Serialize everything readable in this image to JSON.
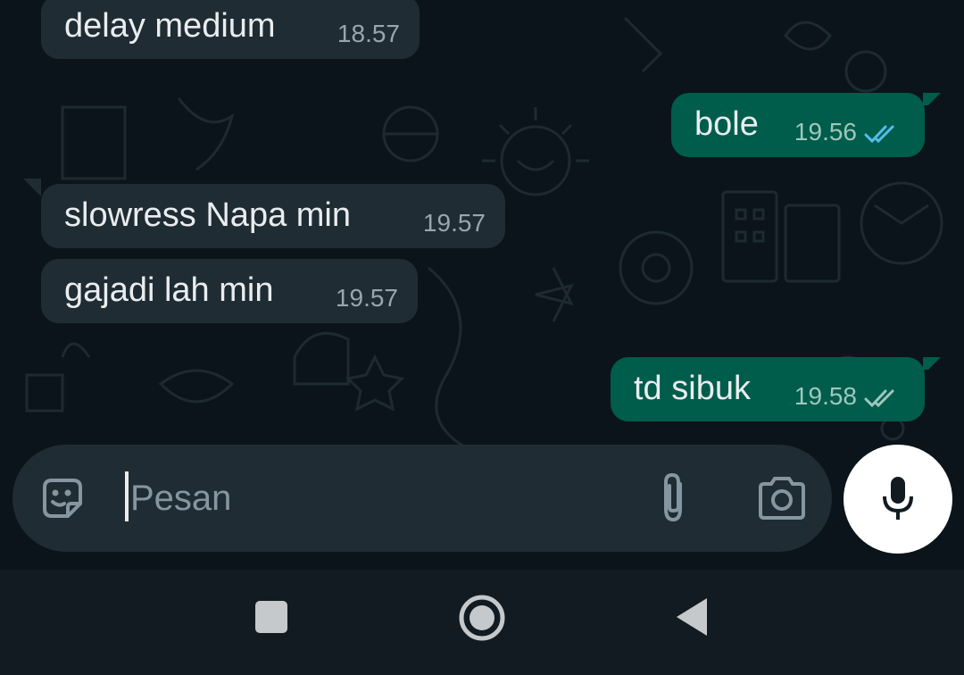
{
  "messages": [
    {
      "direction": "in",
      "text": "delay medium",
      "time": "18.57"
    },
    {
      "direction": "out",
      "text": "bole",
      "time": "19.56",
      "status": "read",
      "tick_color": "#53bdeb"
    },
    {
      "direction": "in",
      "text": "slowress Napa min",
      "time": "19.57"
    },
    {
      "direction": "in",
      "text": "gajadi lah min",
      "time": "19.57"
    },
    {
      "direction": "out",
      "text": "td sibuk",
      "time": "19.58",
      "status": "delivered",
      "tick_color": "#9fc7bd"
    }
  ],
  "composer": {
    "placeholder": "Pesan",
    "icons": [
      "sticker-icon",
      "attach-icon",
      "camera-icon"
    ],
    "mic_icon": "mic-icon"
  },
  "navbar": {
    "buttons": [
      "recents-button",
      "home-button",
      "back-button"
    ]
  },
  "colors": {
    "background": "#0b141a",
    "incoming_bubble": "#202c33",
    "outgoing_bubble": "#005c4b",
    "read_tick": "#53bdeb",
    "text": "#e9edef"
  }
}
